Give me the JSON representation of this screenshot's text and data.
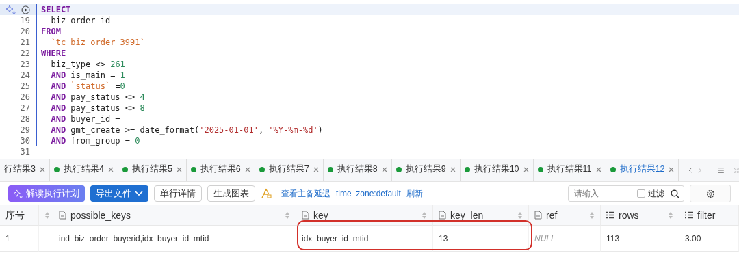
{
  "editor": {
    "current_line": {
      "selected": true
    },
    "lines": [
      {
        "tokens": [
          {
            "kind": "keyword",
            "text": "SELECT"
          }
        ]
      },
      {
        "number": "19",
        "tokens": [
          {
            "kind": "plain",
            "text": "  biz_order_id"
          }
        ]
      },
      {
        "number": "20",
        "tokens": [
          {
            "kind": "keyword",
            "text": "FROM"
          }
        ]
      },
      {
        "number": "21",
        "tokens": [
          {
            "kind": "string",
            "text": "  `tc_biz_order_3991`"
          }
        ]
      },
      {
        "number": "22",
        "tokens": [
          {
            "kind": "keyword",
            "text": "WHERE"
          }
        ]
      },
      {
        "number": "23",
        "tokens": [
          {
            "kind": "plain",
            "text": "  biz_type <> "
          },
          {
            "kind": "number",
            "text": "261"
          }
        ]
      },
      {
        "number": "24",
        "tokens": [
          {
            "kind": "keyword",
            "text": "  AND"
          },
          {
            "kind": "plain",
            "text": " is_main = "
          },
          {
            "kind": "number",
            "text": "1"
          }
        ]
      },
      {
        "number": "25",
        "tokens": [
          {
            "kind": "keyword",
            "text": "  AND"
          },
          {
            "kind": "string",
            "text": " `status`"
          },
          {
            "kind": "plain",
            "text": " ="
          },
          {
            "kind": "number",
            "text": "0"
          }
        ]
      },
      {
        "number": "26",
        "tokens": [
          {
            "kind": "keyword",
            "text": "  AND"
          },
          {
            "kind": "plain",
            "text": " pay_status <> "
          },
          {
            "kind": "number",
            "text": "4"
          }
        ]
      },
      {
        "number": "27",
        "tokens": [
          {
            "kind": "keyword",
            "text": "  AND"
          },
          {
            "kind": "plain",
            "text": " pay_status <> "
          },
          {
            "kind": "number",
            "text": "8"
          }
        ]
      },
      {
        "number": "28",
        "tokens": [
          {
            "kind": "keyword",
            "text": "  AND"
          },
          {
            "kind": "plain",
            "text": " buyer_id ="
          }
        ]
      },
      {
        "number": "29",
        "tokens": [
          {
            "kind": "keyword",
            "text": "  AND"
          },
          {
            "kind": "plain",
            "text": " gmt_create >= date_format("
          },
          {
            "kind": "literal",
            "text": "'2025-01-01'"
          },
          {
            "kind": "plain",
            "text": ", "
          },
          {
            "kind": "literal",
            "text": "'%Y-%m-%d'"
          },
          {
            "kind": "plain",
            "text": ")"
          }
        ]
      },
      {
        "number": "30",
        "tokens": [
          {
            "kind": "keyword",
            "text": "  AND"
          },
          {
            "kind": "plain",
            "text": " from_group = "
          },
          {
            "kind": "number",
            "text": "0"
          }
        ]
      },
      {
        "number": "31"
      }
    ]
  },
  "result_tabs": [
    {
      "label": "行结果3",
      "selected": false,
      "dot": false
    },
    {
      "label": "执行结果4",
      "selected": false,
      "dot": true
    },
    {
      "label": "执行结果5",
      "selected": false,
      "dot": true
    },
    {
      "label": "执行结果6",
      "selected": false,
      "dot": true
    },
    {
      "label": "执行结果7",
      "selected": false,
      "dot": true
    },
    {
      "label": "执行结果8",
      "selected": false,
      "dot": true
    },
    {
      "label": "执行结果9",
      "selected": false,
      "dot": true
    },
    {
      "label": "执行结果10",
      "selected": false,
      "dot": true
    },
    {
      "label": "执行结果11",
      "selected": false,
      "dot": true
    },
    {
      "label": "执行结果12",
      "selected": true,
      "dot": true
    }
  ],
  "toolbar": {
    "buttons": [
      {
        "kind": "ai",
        "label": "解读执行计划"
      },
      {
        "kind": "dropdown",
        "label": "导出文件"
      },
      {
        "kind": "plain",
        "label": "单行详情"
      },
      {
        "kind": "plain",
        "label": "生成图表"
      }
    ],
    "links": [
      "查看主备延迟",
      "time_zone:default",
      "刷新"
    ],
    "search": {
      "placeholder": "请输入"
    },
    "filter": {
      "label": "过滤",
      "checked": false
    }
  },
  "table": {
    "columns": [
      {
        "kind": "index",
        "label": "序号",
        "sortable": false
      },
      {
        "kind": "handle",
        "sortable": true
      },
      {
        "kind": "text",
        "label": "possible_keys",
        "sortable": true
      },
      {
        "kind": "text",
        "label": "key",
        "sortable": true
      },
      {
        "kind": "text",
        "label": "key_len",
        "sortable": true
      },
      {
        "kind": "text",
        "label": "ref",
        "sortable": true
      },
      {
        "kind": "numeric",
        "label": "rows",
        "sortable": true
      },
      {
        "kind": "numeric",
        "label": "filter",
        "sortable": false
      }
    ],
    "rows": [
      {
        "cells": [
          {
            "kind": "text",
            "text": "1"
          },
          {
            "kind": "empty"
          },
          {
            "kind": "text",
            "text": "ind_biz_order_buyerid,idx_buyer_id_mtid"
          },
          {
            "kind": "text",
            "text": "idx_buyer_id_mtid"
          },
          {
            "kind": "text",
            "text": "13"
          },
          {
            "kind": "null",
            "text": "NULL"
          },
          {
            "kind": "text",
            "text": "113"
          },
          {
            "kind": "text",
            "text": "3.00"
          }
        ]
      }
    ]
  },
  "annotation": {
    "kind": "rounded-frame",
    "color": "#d2302a"
  }
}
